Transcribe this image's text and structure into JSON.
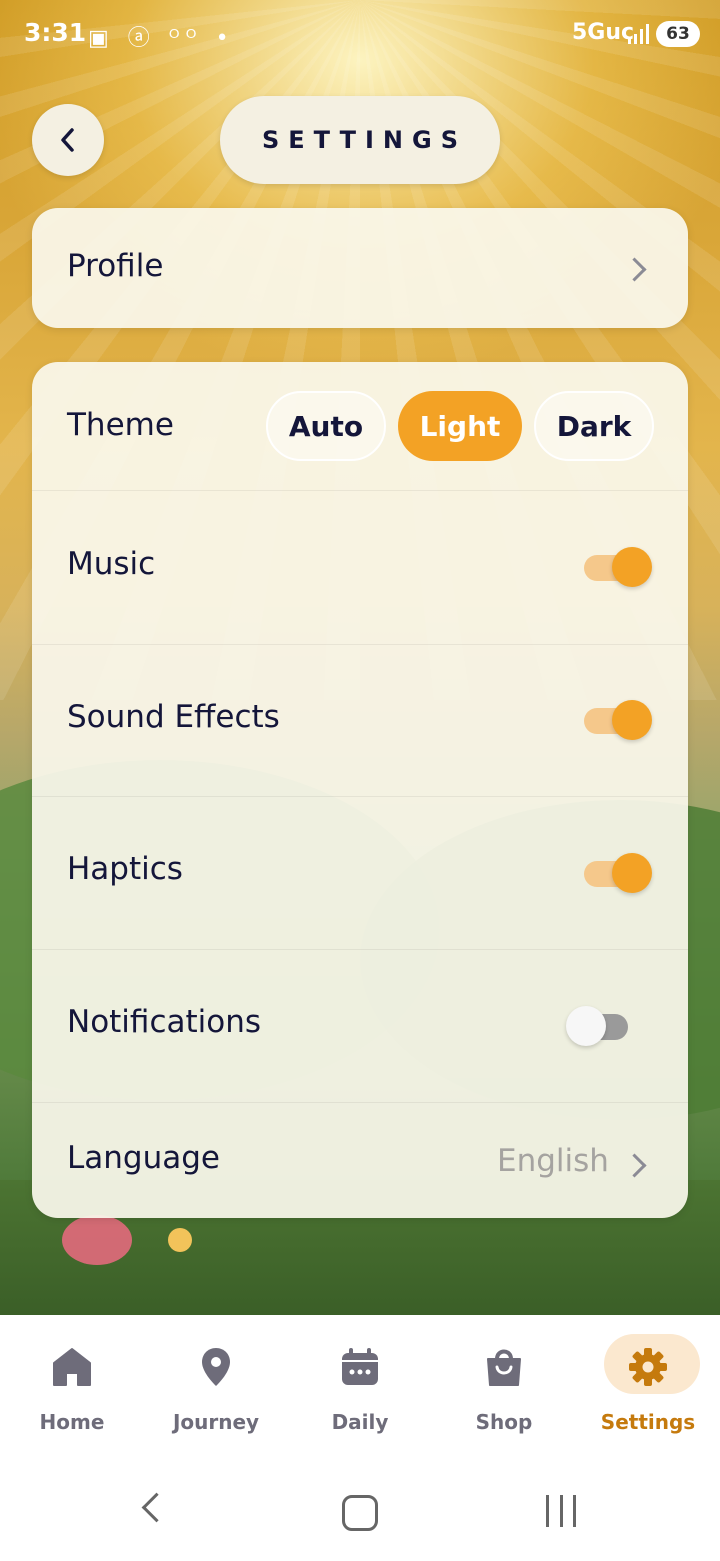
{
  "status_bar": {
    "time": "3:31",
    "network": "5Guc",
    "battery": "63"
  },
  "header": {
    "title": "SETTINGS"
  },
  "profile": {
    "label": "Profile"
  },
  "theme": {
    "label": "Theme",
    "options": [
      "Auto",
      "Light",
      "Dark"
    ],
    "selected": "Light"
  },
  "toggles": {
    "music": {
      "label": "Music",
      "on": true
    },
    "sound_effects": {
      "label": "Sound Effects",
      "on": true
    },
    "haptics": {
      "label": "Haptics",
      "on": true
    },
    "notifications": {
      "label": "Notifications",
      "on": false
    }
  },
  "language": {
    "label": "Language",
    "value": "English"
  },
  "tabs": [
    {
      "label": "Home",
      "icon": "home-icon"
    },
    {
      "label": "Journey",
      "icon": "map-pin-icon"
    },
    {
      "label": "Daily",
      "icon": "calendar-icon"
    },
    {
      "label": "Shop",
      "icon": "shopping-bag-icon"
    },
    {
      "label": "Settings",
      "icon": "gear-icon",
      "active": true
    }
  ],
  "colors": {
    "accent": "#f3a225",
    "active_tab_text": "#c57a0d",
    "text": "#14163a"
  }
}
